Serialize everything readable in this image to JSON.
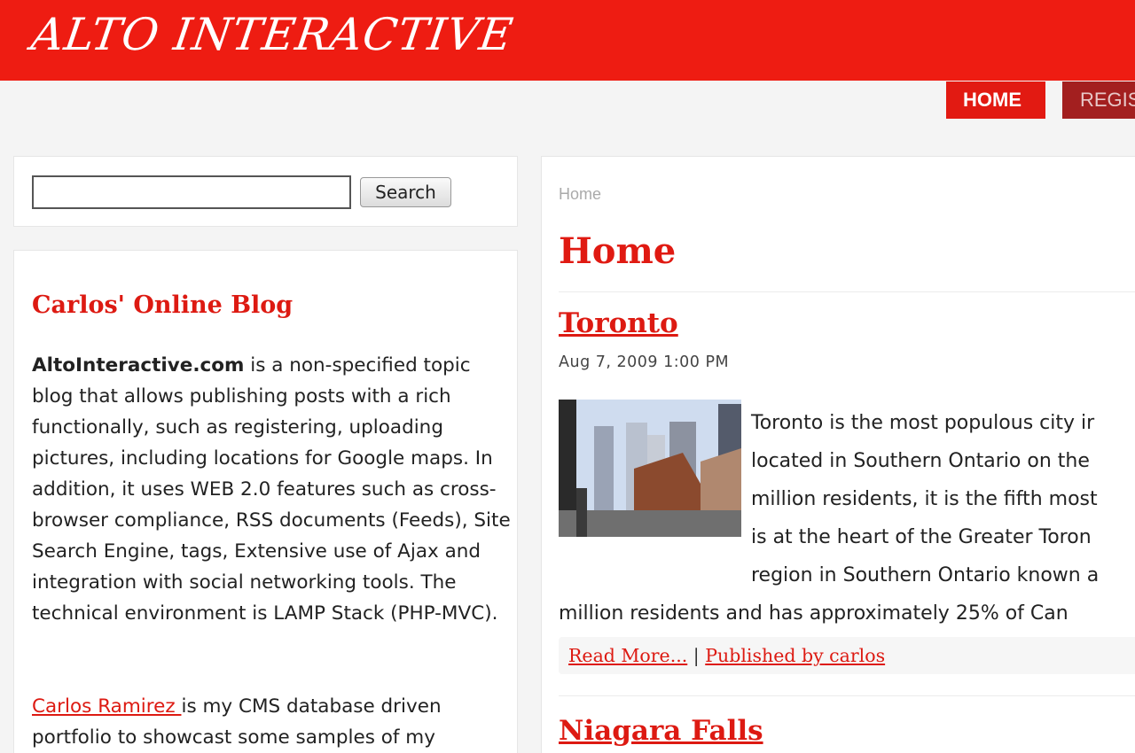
{
  "header": {
    "logo_text": "ALTO INTERACTIVE",
    "bg_color": "#ee1c12"
  },
  "nav": {
    "tabs": [
      {
        "label": "HOME",
        "active": true
      },
      {
        "label": "REGIS"
      }
    ]
  },
  "search": {
    "input_value": "",
    "button_label": "Search"
  },
  "about": {
    "title": "Carlos' Online Blog",
    "site_name": "AltoInteractive.com",
    "description": " is a non-specified topic blog that allows publishing posts with a rich functionally, such as registering, uploading pictures, including locations for Google maps. In addition, it uses WEB 2.0 features such as cross-browser compliance, RSS documents (Feeds), Site Search Engine, tags, Extensive use of Ajax and integration with social networking tools. The technical environment is LAMP Stack (PHP-MVC).",
    "portfolio_link": "Carlos Ramirez ",
    "portfolio_text": "is my CMS database driven portfolio to showcast some samples of my"
  },
  "main": {
    "breadcrumb": "Home",
    "title": "Home",
    "posts": [
      {
        "title": "Toronto",
        "date": "Aug 7, 2009 1:00 PM",
        "lines": [
          "Toronto is the most populous city ir",
          "located in Southern Ontario on the",
          "million residents, it is the fifth most",
          "is at the heart of the Greater Toron",
          "region in Southern Ontario known a",
          "million residents and has approximately 25% of Can"
        ],
        "read_more": "Read More...",
        "separator": "|",
        "published_by": "Published by carlos"
      },
      {
        "title": "Niagara Falls"
      }
    ]
  }
}
